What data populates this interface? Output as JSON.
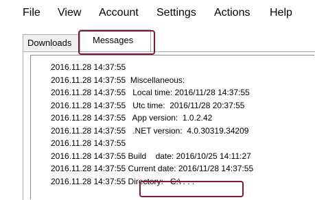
{
  "menubar": {
    "items": [
      {
        "label": "File"
      },
      {
        "label": "View"
      },
      {
        "label": "Account"
      },
      {
        "label": "Settings"
      },
      {
        "label": "Actions"
      },
      {
        "label": "Help"
      }
    ]
  },
  "tabs": {
    "downloads_label": "Downloads",
    "messages_label": "Messages",
    "active": "Messages"
  },
  "log": {
    "lines": [
      "2016.11.28 14:37:55",
      "2016.11.28 14:37:55  Miscellaneous:",
      "2016.11.28 14:37:55   Local time: 2016/11/28 14:37:55",
      "2016.11.28 14:37:55   Utc time:  2016/11/28 20:37:55",
      "2016.11.28 14:37:55   App version:  1.0.2.42",
      "2016.11.28 14:37:55   .NET version:  4.0.30319.34209",
      "2016.11.28 14:37:55",
      "2016.11.28 14:37:55 Build    date: 2016/10/25 14:11:27",
      "2016.11.28 14:37:55 Current date: 2016/11/28 14:37:55",
      "2016.11.28 14:37:55 Directory:   C:\\ . . ."
    ]
  },
  "colors": {
    "highlight": "#7b1a2e",
    "border": "#adadad",
    "inactive_tab": "#f0f0f0"
  }
}
